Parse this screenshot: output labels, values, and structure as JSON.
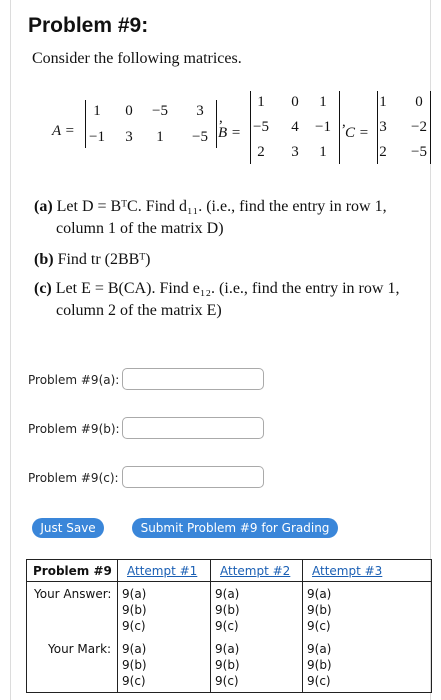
{
  "title": "Problem #9:",
  "intro": "Consider the following matrices.",
  "matrices": {
    "A": {
      "label": "A =",
      "rows": [
        [
          "1",
          "0",
          "−5",
          "3"
        ],
        [
          "−1",
          "3",
          "1",
          "−5"
        ]
      ],
      "sep": ","
    },
    "B": {
      "label": "B =",
      "rows": [
        [
          "1",
          "0",
          "1"
        ],
        [
          "−5",
          "4",
          "−1"
        ],
        [
          "2",
          "3",
          "1"
        ]
      ],
      "sep": ","
    },
    "C": {
      "label": "C =",
      "rows": [
        [
          "1",
          "0"
        ],
        [
          "3",
          "−2"
        ],
        [
          "2",
          "−5"
        ]
      ]
    }
  },
  "parts": {
    "a": {
      "tag": "(a)",
      "line1": "Let D = BᵀC.  Find d₁₁. (i.e., find the entry in row 1,",
      "line2": "column 1 of the matrix D)"
    },
    "b": {
      "tag": "(b)",
      "line1": "Find tr (2BBᵀ)"
    },
    "c": {
      "tag": "(c)",
      "line1": "Let E = B(CA).  Find e₁₂. (i.e., find the entry in row 1,",
      "line2": "column 2 of the matrix E)"
    }
  },
  "answers": [
    {
      "label": "Problem #9(a):",
      "value": ""
    },
    {
      "label": "Problem #9(b):",
      "value": ""
    },
    {
      "label": "Problem #9(c):",
      "value": ""
    }
  ],
  "buttons": {
    "just_save": "Just Save",
    "submit": "Submit Problem #9 for Grading"
  },
  "status_table": {
    "corner": "Problem #9",
    "attempts": [
      "Attempt #1",
      "Attempt #2",
      "Attempt #3"
    ],
    "your_answer_label": "Your Answer:",
    "your_mark_label": "Your Mark:",
    "items": [
      "9(a)",
      "9(b)",
      "9(c)"
    ]
  }
}
